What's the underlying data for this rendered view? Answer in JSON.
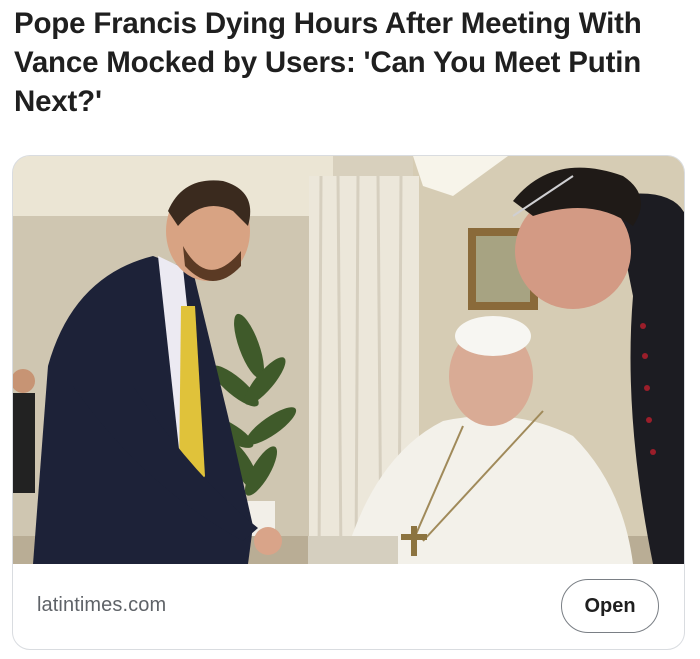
{
  "post": {
    "headline": "Pope Francis Dying Hours After Meeting With Vance Mocked by Users: 'Can You Meet Putin Next?'"
  },
  "link_card": {
    "thumbnail_alt": "Photo of JD Vance shaking hands with Pope Francis",
    "domain": "latintimes.com",
    "open_label": "Open"
  },
  "colors": {
    "headline_text": "#1f1f1f",
    "domain_text": "#5f6368",
    "card_border": "#d9dce0",
    "button_border": "#7a7f85"
  }
}
